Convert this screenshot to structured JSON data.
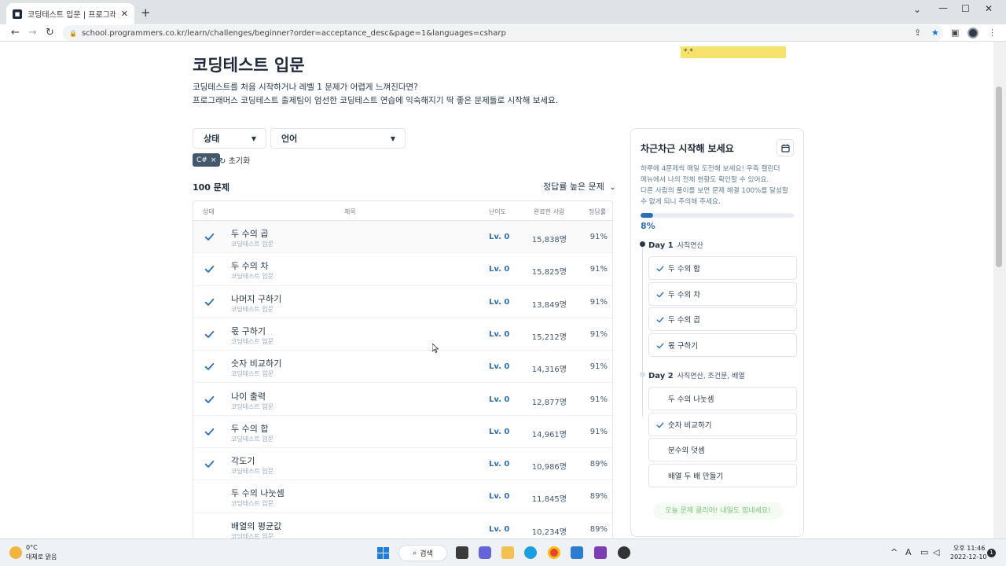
{
  "browser": {
    "tab_title": "코딩테스트 입문 | 프로그래머스",
    "url": "school.programmers.co.kr/learn/challenges/beginner?order=acceptance_desc&page=1&languages=csharp"
  },
  "page": {
    "title": "코딩테스트 입문",
    "intro_line1": "코딩테스트를 처음 시작하거나 레벨 1 문제가 어렵게 느껴진다면?",
    "intro_line2": "프로그래머스 코딩테스트 출제팀이 엄선한 코딩테스트 연습에 익숙해지기 딱 좋은 문제들로 시작해 보세요.",
    "sticky_note": "*.*"
  },
  "filters": {
    "status_label": "상태",
    "language_label": "언어",
    "active_chip": "C#",
    "chip_remove": "×",
    "reset_label": "초기화"
  },
  "list": {
    "count": "100 문제",
    "sort_label": "정답률 높은 문제",
    "headers": {
      "status": "상태",
      "title": "제목",
      "level": "난이도",
      "completed": "완료한 사람",
      "rate": "정답률"
    },
    "rows": [
      {
        "title": "두 수의 곱",
        "sub": "코딩테스트 입문",
        "level": "Lv. 0",
        "completed": "15,838명",
        "rate": "91%",
        "solved": true
      },
      {
        "title": "두 수의 차",
        "sub": "코딩테스트 입문",
        "level": "Lv. 0",
        "completed": "15,825명",
        "rate": "91%",
        "solved": true
      },
      {
        "title": "나머지 구하기",
        "sub": "코딩테스트 입문",
        "level": "Lv. 0",
        "completed": "13,849명",
        "rate": "91%",
        "solved": true
      },
      {
        "title": "몫 구하기",
        "sub": "코딩테스트 입문",
        "level": "Lv. 0",
        "completed": "15,212명",
        "rate": "91%",
        "solved": true
      },
      {
        "title": "숫자 비교하기",
        "sub": "코딩테스트 입문",
        "level": "Lv. 0",
        "completed": "14,316명",
        "rate": "91%",
        "solved": true
      },
      {
        "title": "나이 출력",
        "sub": "코딩테스트 입문",
        "level": "Lv. 0",
        "completed": "12,877명",
        "rate": "91%",
        "solved": true
      },
      {
        "title": "두 수의 합",
        "sub": "코딩테스트 입문",
        "level": "Lv. 0",
        "completed": "14,961명",
        "rate": "91%",
        "solved": true
      },
      {
        "title": "각도기",
        "sub": "코딩테스트 입문",
        "level": "Lv. 0",
        "completed": "10,986명",
        "rate": "89%",
        "solved": true
      },
      {
        "title": "두 수의 나눗셈",
        "sub": "코딩테스트 입문",
        "level": "Lv. 0",
        "completed": "11,845명",
        "rate": "89%",
        "solved": false
      },
      {
        "title": "배열의 평균값",
        "sub": "코딩테스트 입문",
        "level": "Lv. 0",
        "completed": "10,234명",
        "rate": "89%",
        "solved": false
      }
    ]
  },
  "panel": {
    "title": "차근차근 시작해 보세요",
    "desc1": "하루에 4문제씩 매일 도전해 보세요! 우측 캘린더",
    "desc2": "메뉴에서 나의 전체 현황도 확인할 수 있어요.",
    "desc3": "다른 사람의 풀이를 보면 문제 해결 100%를 달성할",
    "desc4": "수 없게 되니 주의해 주세요.",
    "progress": 0.08,
    "percent": "8%",
    "day1": {
      "label": "Day 1",
      "topic": "사칙연산",
      "items": [
        "두 수의 합",
        "두 수의 차",
        "두 수의 곱",
        "몫 구하기"
      ]
    },
    "day2": {
      "label": "Day 2",
      "topic": "사칙연산, 조건문, 배열",
      "items": [
        "두 수의 나눗셈",
        "숫자 비교하기",
        "분수의 덧셈",
        "배열 두 배 만들기"
      ]
    },
    "cheer": "오늘 문제 클리어! 내일도 힘내세요!"
  },
  "taskbar": {
    "temp": "0°C",
    "weather": "대체로 맑음",
    "search": "검색",
    "time": "오후 11:46",
    "date": "2022-12-10",
    "notifications": "1"
  },
  "colors": {
    "accent": "#2d6fb8",
    "check": "#2d6fb8",
    "note": "#f7e26b"
  }
}
